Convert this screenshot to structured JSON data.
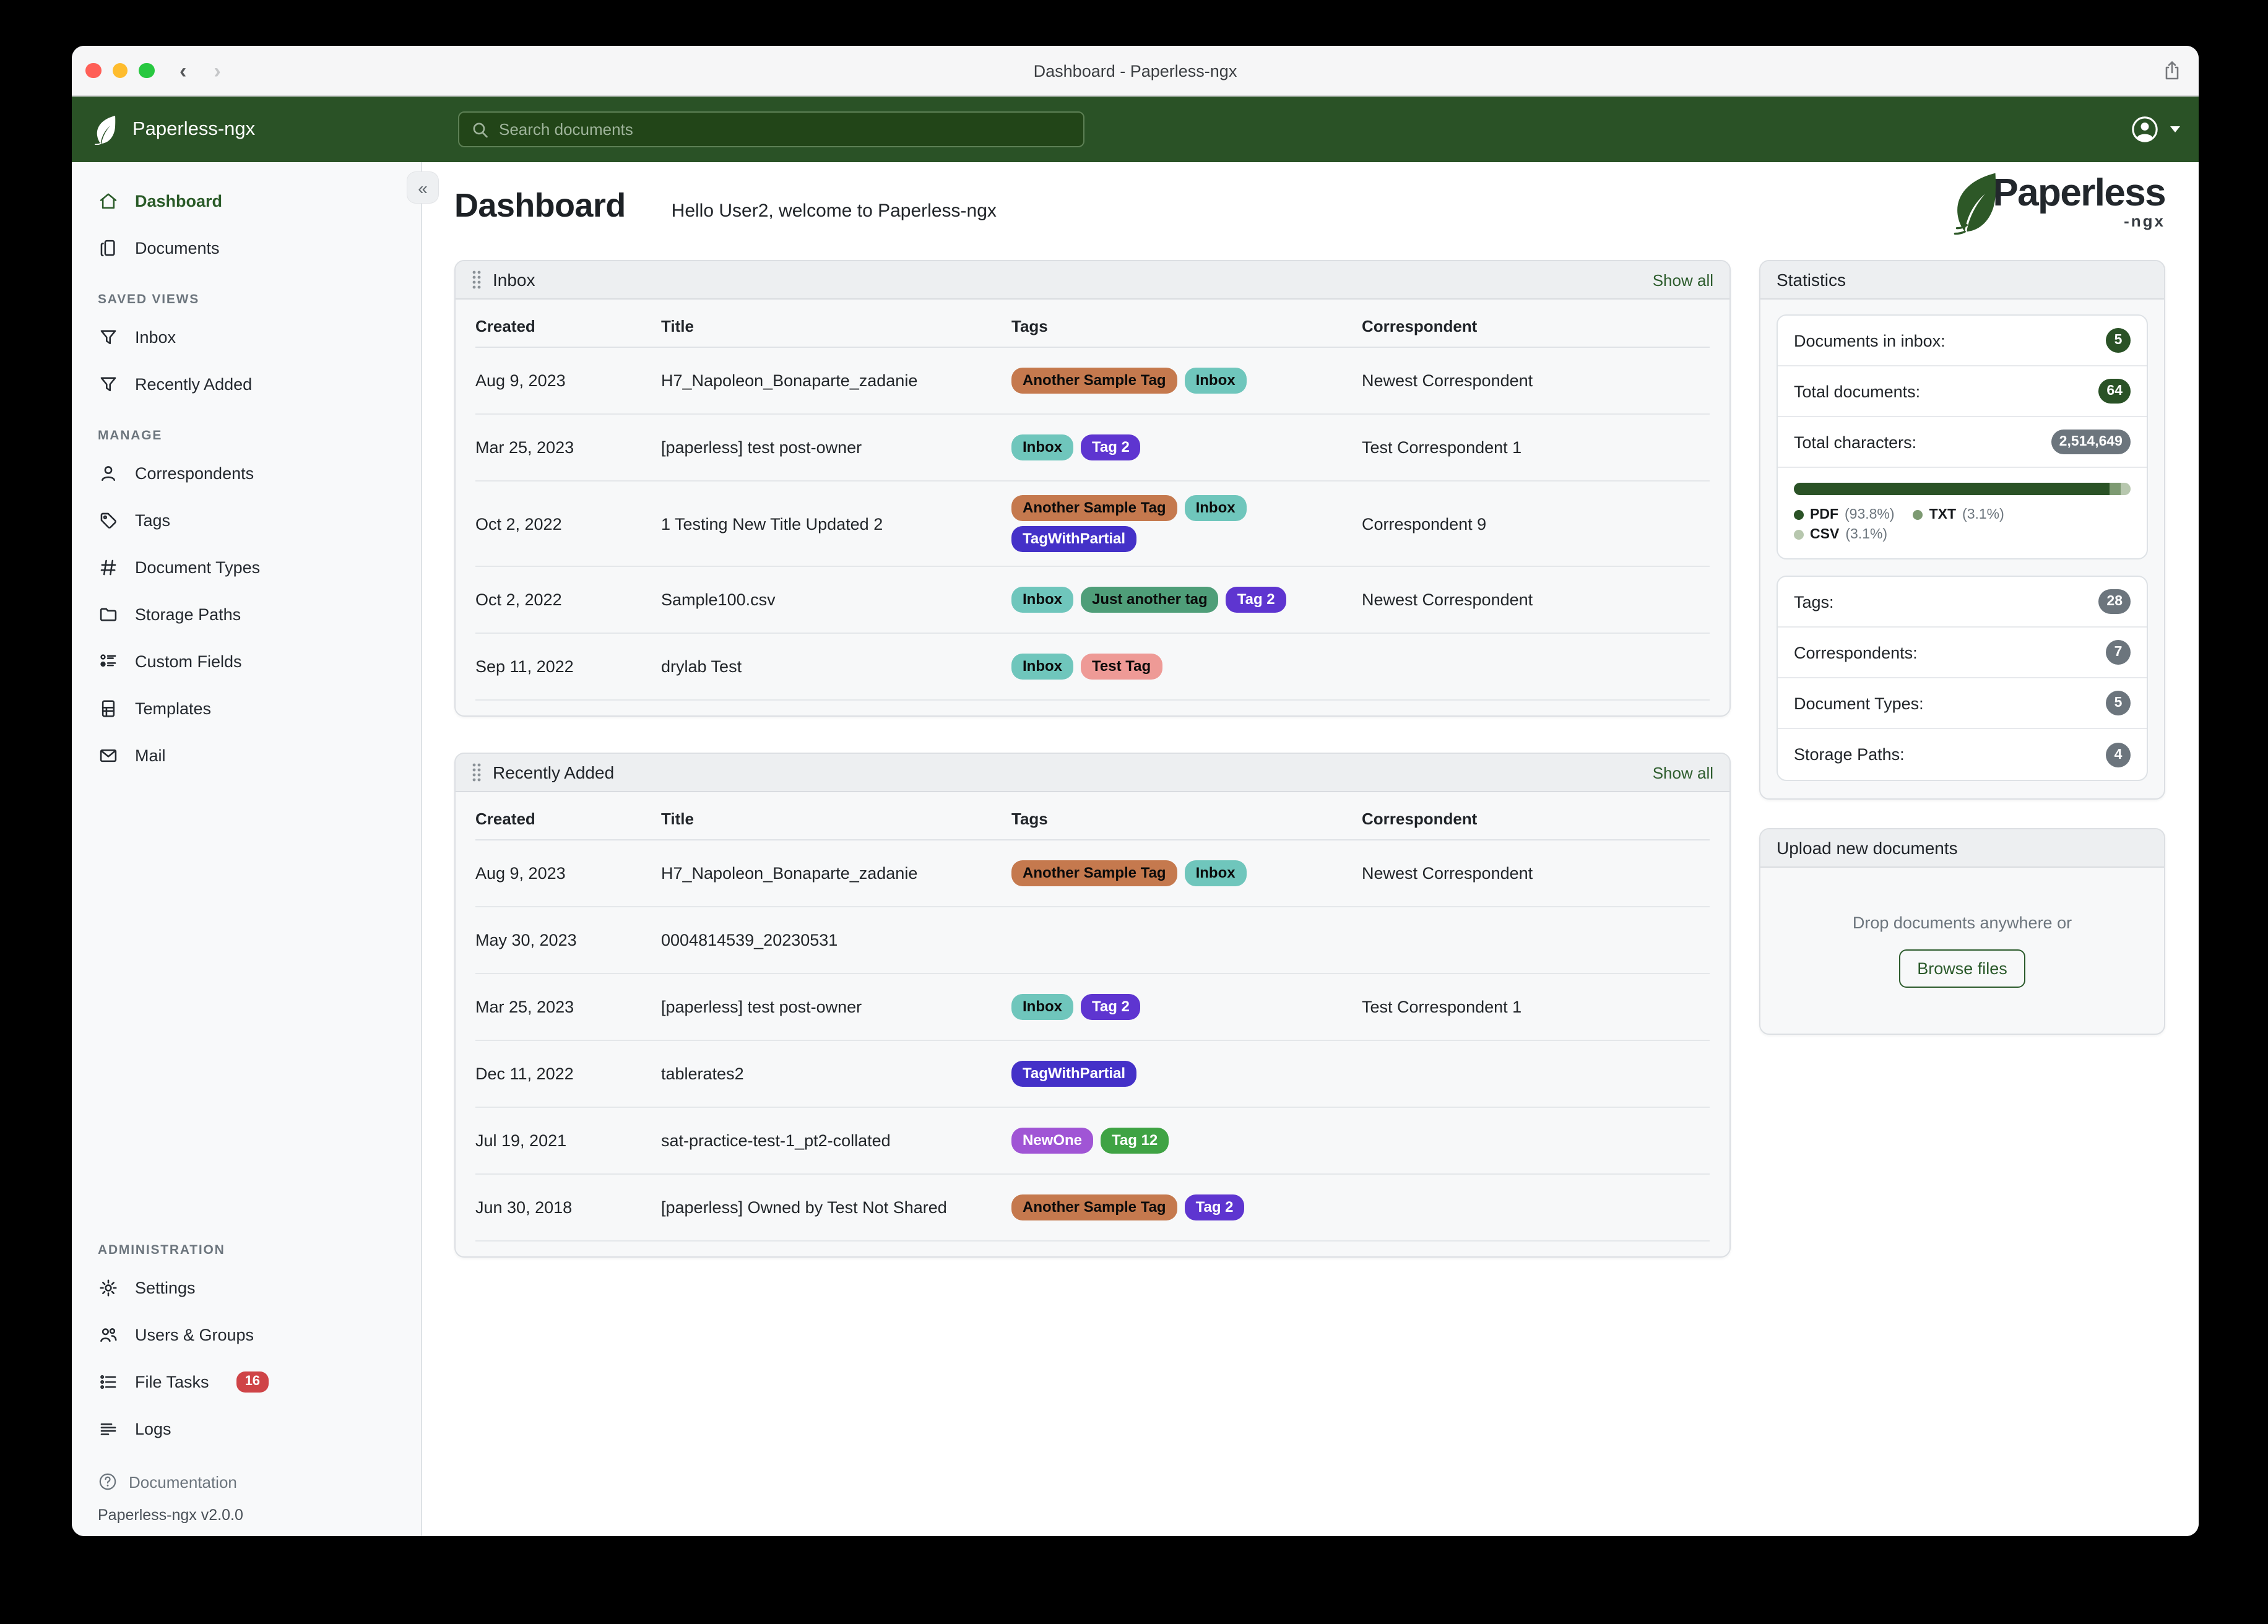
{
  "window": {
    "title": "Dashboard - Paperless-ngx"
  },
  "appbar": {
    "brand": "Paperless-ngx",
    "search_placeholder": "Search documents"
  },
  "sidebar": {
    "primary": [
      {
        "label": "Dashboard",
        "icon": "home",
        "active": true
      },
      {
        "label": "Documents",
        "icon": "documents",
        "active": false
      }
    ],
    "saved_views_label": "SAVED VIEWS",
    "saved_views": [
      {
        "label": "Inbox",
        "icon": "filter"
      },
      {
        "label": "Recently Added",
        "icon": "filter"
      }
    ],
    "manage_label": "MANAGE",
    "manage": [
      {
        "label": "Correspondents",
        "icon": "person"
      },
      {
        "label": "Tags",
        "icon": "tag"
      },
      {
        "label": "Document Types",
        "icon": "hash"
      },
      {
        "label": "Storage Paths",
        "icon": "folder"
      },
      {
        "label": "Custom Fields",
        "icon": "custom"
      },
      {
        "label": "Templates",
        "icon": "template"
      },
      {
        "label": "Mail",
        "icon": "mail"
      }
    ],
    "admin_label": "ADMINISTRATION",
    "admin": [
      {
        "label": "Settings",
        "icon": "gear"
      },
      {
        "label": "Users & Groups",
        "icon": "users"
      },
      {
        "label": "File Tasks",
        "icon": "tasks",
        "badge": "16"
      },
      {
        "label": "Logs",
        "icon": "logs"
      }
    ],
    "footer": {
      "documentation": "Documentation",
      "version": "Paperless-ngx v2.0.0"
    }
  },
  "page": {
    "title": "Dashboard",
    "greeting": "Hello User2, welcome to Paperless-ngx",
    "logo_text": "Paperless",
    "logo_suffix": "-ngx"
  },
  "tables": {
    "columns": [
      "Created",
      "Title",
      "Tags",
      "Correspondent"
    ],
    "inbox": {
      "title": "Inbox",
      "show_all": "Show all",
      "rows": [
        {
          "created": "Aug 9, 2023",
          "title": "H7_Napoleon_Bonaparte_zadanie",
          "tags": [
            "Another Sample Tag",
            "Inbox"
          ],
          "correspondent": "Newest Correspondent"
        },
        {
          "created": "Mar 25, 2023",
          "title": "[paperless] test post-owner",
          "tags": [
            "Inbox",
            "Tag 2"
          ],
          "correspondent": "Test Correspondent 1"
        },
        {
          "created": "Oct 2, 2022",
          "title": "1 Testing New Title Updated 2",
          "tags": [
            "Another Sample Tag",
            "Inbox",
            "TagWithPartial"
          ],
          "correspondent": "Correspondent 9"
        },
        {
          "created": "Oct 2, 2022",
          "title": "Sample100.csv",
          "tags": [
            "Inbox",
            "Just another tag",
            "Tag 2"
          ],
          "correspondent": "Newest Correspondent"
        },
        {
          "created": "Sep 11, 2022",
          "title": "drylab Test",
          "tags": [
            "Inbox",
            "Test Tag"
          ],
          "correspondent": ""
        }
      ]
    },
    "recently_added": {
      "title": "Recently Added",
      "show_all": "Show all",
      "rows": [
        {
          "created": "Aug 9, 2023",
          "title": "H7_Napoleon_Bonaparte_zadanie",
          "tags": [
            "Another Sample Tag",
            "Inbox"
          ],
          "correspondent": "Newest Correspondent"
        },
        {
          "created": "May 30, 2023",
          "title": "0004814539_20230531",
          "tags": [],
          "correspondent": ""
        },
        {
          "created": "Mar 25, 2023",
          "title": "[paperless] test post-owner",
          "tags": [
            "Inbox",
            "Tag 2"
          ],
          "correspondent": "Test Correspondent 1"
        },
        {
          "created": "Dec 11, 2022",
          "title": "tablerates2",
          "tags": [
            "TagWithPartial"
          ],
          "correspondent": ""
        },
        {
          "created": "Jul 19, 2021",
          "title": "sat-practice-test-1_pt2-collated",
          "tags": [
            "NewOne",
            "Tag 12"
          ],
          "correspondent": ""
        },
        {
          "created": "Jun 30, 2018",
          "title": "[paperless] Owned by Test Not Shared",
          "tags": [
            "Another Sample Tag",
            "Tag 2"
          ],
          "correspondent": ""
        }
      ]
    }
  },
  "tag_palette": {
    "Another Sample Tag": {
      "bg": "#c5794e",
      "fg": "#0b0b0b"
    },
    "Inbox": {
      "bg": "#6fc6bc",
      "fg": "#0b0b0b"
    },
    "Tag 2": {
      "bg": "#5e35d0",
      "fg": "#ffffff"
    },
    "TagWithPartial": {
      "bg": "#4431c8",
      "fg": "#ffffff"
    },
    "Just another tag": {
      "bg": "#4f9e79",
      "fg": "#0b0b0b"
    },
    "Test Tag": {
      "bg": "#ee9a96",
      "fg": "#0b0b0b"
    },
    "NewOne": {
      "bg": "#a055d5",
      "fg": "#ffffff"
    },
    "Tag 12": {
      "bg": "#3fa344",
      "fg": "#ffffff"
    }
  },
  "statistics": {
    "title": "Statistics",
    "rows": [
      {
        "label": "Documents in inbox:",
        "value": "5",
        "color": "#2a5226"
      },
      {
        "label": "Total documents:",
        "value": "64",
        "color": "#2a5226"
      },
      {
        "label": "Total characters:",
        "value": "2,514,649",
        "color": "#6c757d"
      }
    ],
    "chart_data": {
      "type": "bar",
      "title": "Document file types",
      "segments": [
        {
          "label": "PDF",
          "pct": 93.8,
          "color": "#2a5226"
        },
        {
          "label": "TXT",
          "pct": 3.1,
          "color": "#7d9a72"
        },
        {
          "label": "CSV",
          "pct": 3.1,
          "color": "#b7c7ae"
        }
      ]
    },
    "counts": [
      {
        "label": "Tags:",
        "value": "28",
        "color": "#6c757d"
      },
      {
        "label": "Correspondents:",
        "value": "7",
        "color": "#6c757d"
      },
      {
        "label": "Document Types:",
        "value": "5",
        "color": "#6c757d"
      },
      {
        "label": "Storage Paths:",
        "value": "4",
        "color": "#6c757d"
      }
    ]
  },
  "upload": {
    "title": "Upload new documents",
    "drop_text": "Drop documents anywhere or",
    "browse_label": "Browse files"
  },
  "colors": {
    "header_green": "#2a5226",
    "accent_green": "#2a5b28",
    "link_green": "#2e5d2e",
    "file_tasks_badge": "#cf4447"
  }
}
